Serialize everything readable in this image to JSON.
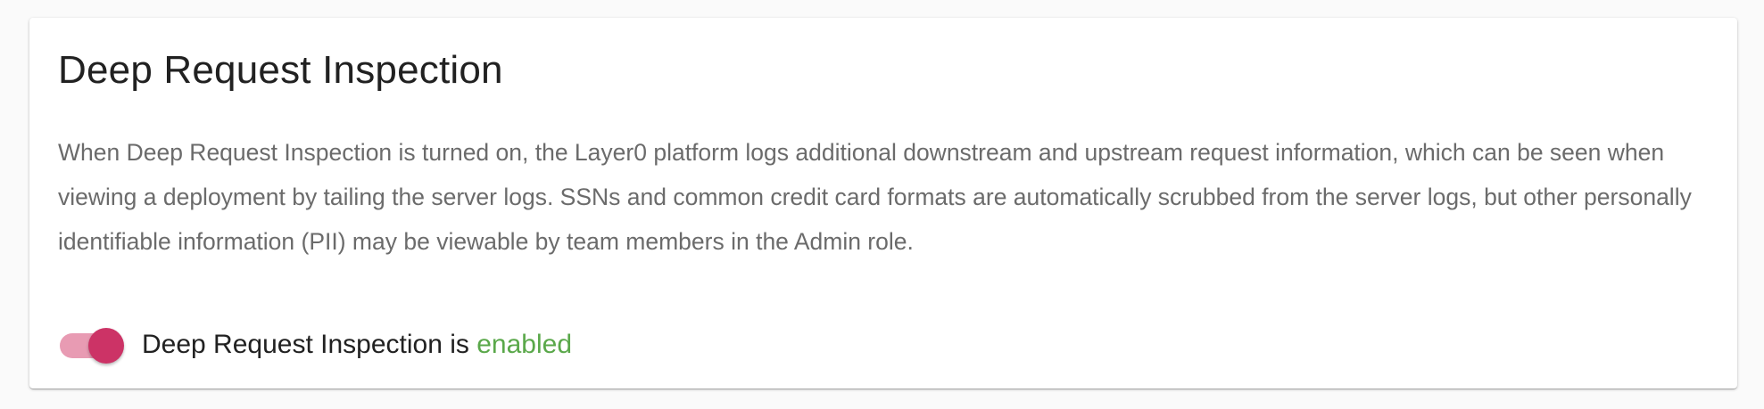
{
  "card": {
    "title": "Deep Request Inspection",
    "description": "When Deep Request Inspection is turned on, the Layer0 platform logs additional downstream and upstream request information, which can be seen when viewing a deployment by tailing the server logs. SSNs and common credit card formats are automatically scrubbed from the server logs, but other personally identifiable information (PII) may be viewable by team members in the Admin role."
  },
  "toggle": {
    "state": "on",
    "label_prefix": "Deep Request Inspection is",
    "status_text": "enabled"
  },
  "colors": {
    "background": "#fafafa",
    "card": "#ffffff",
    "switch_thumb": "#cc3366",
    "switch_track": "#e89bb3",
    "status_enabled": "#5aa84a",
    "title_text": "#212121",
    "body_text": "#6b6b6b"
  }
}
